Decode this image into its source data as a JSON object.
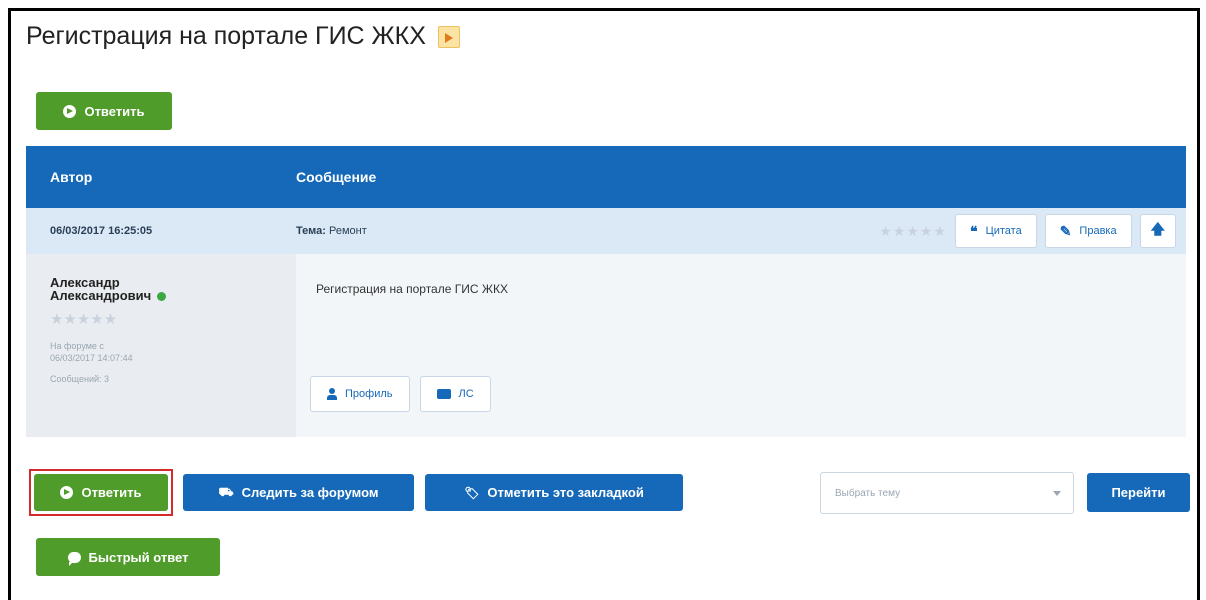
{
  "page": {
    "title": "Регистрация на портале ГИС ЖКХ"
  },
  "top_actions": {
    "reply_label": "Ответить"
  },
  "table": {
    "headers": {
      "author": "Автор",
      "message": "Сообщение"
    },
    "post": {
      "date": "06/03/2017 16:25:05",
      "topic_label": "Тема:",
      "topic_value": "Ремонт",
      "rating_stars": "★★★★★",
      "quote_label": "Цитата",
      "edit_label": "Правка",
      "author_name_line1": "Александр",
      "author_name_line2": "Александрович",
      "author_stars": "★★★★★",
      "author_meta_line1": "На форуме с",
      "author_meta_line2": "06/03/2017 14:07:44",
      "author_messages": "Сообщений: 3",
      "text": "Регистрация на портале ГИС ЖКХ",
      "profile_label": "Профиль",
      "pm_label": "ЛС"
    }
  },
  "bottom_actions": {
    "reply_label": "Ответить",
    "follow_label": "Следить за форумом",
    "bookmark_label": "Отметить это закладкой",
    "select_placeholder": "Выбрать тему",
    "go_label": "Перейти",
    "quick_reply_label": "Быстрый ответ"
  },
  "colors": {
    "green": "#4f9c2a",
    "blue": "#1569b8",
    "red_outline": "#d32a2a"
  }
}
